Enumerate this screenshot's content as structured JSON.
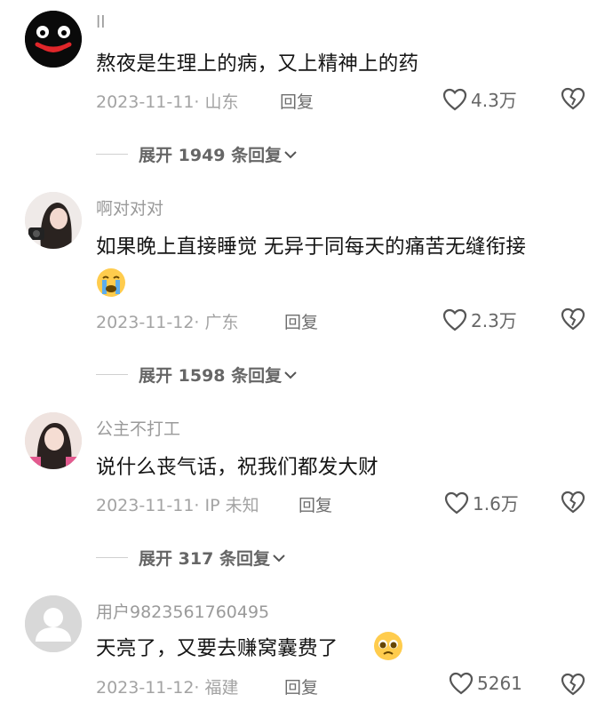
{
  "comments": [
    {
      "username": "ll",
      "text": "熬夜是生理上的病，又上精神上的药",
      "date": "2023-11-11",
      "location": "山东",
      "reply_label": "回复",
      "likes": "4.3万",
      "expand_count": "1949",
      "expand_prefix": "展开",
      "expand_suffix": "条回复"
    },
    {
      "username": "啊对对对",
      "text": "如果晚上直接睡觉 无异于同每天的痛苦无缝衔接",
      "emoji": "crying-face-icon",
      "date": "2023-11-12",
      "location": "广东",
      "reply_label": "回复",
      "likes": "2.3万",
      "expand_count": "1598",
      "expand_prefix": "展开",
      "expand_suffix": "条回复"
    },
    {
      "username": "公主不打工",
      "text": "说什么丧气话，祝我们都发大财",
      "date": "2023-11-11",
      "location": "IP 未知",
      "reply_label": "回复",
      "likes": "1.6万",
      "expand_count": "317",
      "expand_prefix": "展开",
      "expand_suffix": "条回复"
    },
    {
      "username": "用户9823561760495",
      "text": "天亮了，又要去赚窝囊费了",
      "emoji": "pleading-face-icon",
      "date": "2023-11-12",
      "location": "福建",
      "reply_label": "回复",
      "likes": "5261"
    }
  ],
  "colors": {
    "meta": "#a3a3a3",
    "username": "#9a9a9a",
    "text": "#151515",
    "icon": "#666666"
  }
}
